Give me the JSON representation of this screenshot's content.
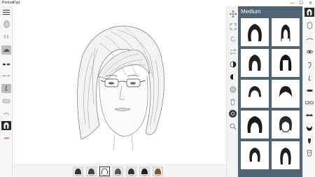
{
  "app": {
    "title": "PortraitPad"
  },
  "window": {
    "minimize": "—",
    "maximize": "☐",
    "close": "✕"
  },
  "panel": {
    "title": "Medium",
    "accent": "#4e6473"
  },
  "left_toolbar": [
    "menu-icon",
    "face-shape-icon",
    "ear-icon",
    "eyebrow-icon",
    "eyes-icon",
    "eyebrows-thin-icon",
    "nose-icon",
    "mustache-icon",
    "hairline-icon",
    "hair-icon",
    "lips-icon"
  ],
  "tools": [
    "move-icon",
    "fit-icon",
    "rotate-icon",
    "flip-icon",
    "contrast-icon",
    "invert-icon",
    "target-icon",
    "delete-icon",
    "settings-icon",
    "zoom-icon"
  ],
  "right_features": [
    "hair-icon",
    "face-icon",
    "eye-icon",
    "ear-icon",
    "nose-icon",
    "lips-icon",
    "glasses-icon",
    "mustache-icon",
    "beard-icon",
    "goatee-icon",
    "accessory-icon"
  ],
  "hairstyles": [
    "medium-hair-1",
    "medium-hair-2",
    "medium-hair-3",
    "medium-hair-4",
    "medium-hair-5",
    "medium-hair-6",
    "medium-hair-7",
    "medium-hair-8",
    "medium-hair-9",
    "medium-hair-10"
  ],
  "history_count": 7,
  "selected_history": 2
}
